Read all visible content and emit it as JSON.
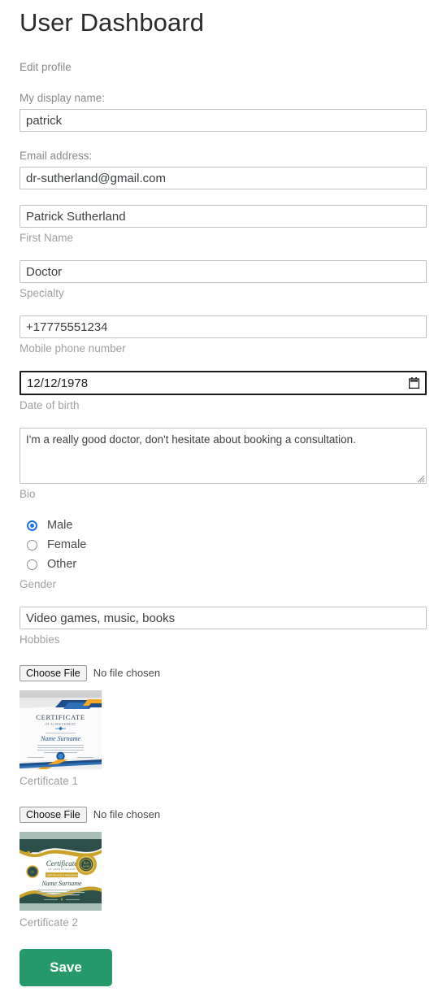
{
  "page": {
    "title": "User Dashboard",
    "section_label": "Edit profile"
  },
  "fields": {
    "display_name": {
      "label": "My display name:",
      "value": "patrick"
    },
    "email": {
      "label": "Email address:",
      "value": "dr-sutherland@gmail.com"
    },
    "first_name": {
      "value": "Patrick Sutherland",
      "helper": "First Name"
    },
    "specialty": {
      "value": "Doctor",
      "helper": "Specialty"
    },
    "mobile_phone": {
      "value": "+17775551234",
      "helper": "Mobile phone number"
    },
    "date_of_birth": {
      "value": "12/12/1978",
      "helper": "Date of birth",
      "icon": "calendar-icon"
    },
    "bio": {
      "value": "I'm a really good doctor, don't hesitate about booking a consultation.",
      "helper": "Bio"
    },
    "gender": {
      "helper": "Gender",
      "selected": "Male",
      "options": [
        {
          "label": "Male",
          "checked": true
        },
        {
          "label": "Female",
          "checked": false
        },
        {
          "label": "Other",
          "checked": false
        }
      ]
    },
    "hobbies": {
      "value": "Video games, music, books",
      "helper": "Hobbies"
    }
  },
  "uploads": [
    {
      "button_label": "Choose File",
      "status": "No file chosen",
      "caption": "Certificate 1",
      "thumbnail": "certificate-blue-gold"
    },
    {
      "button_label": "Choose File",
      "status": "No file chosen",
      "caption": "Certificate 2",
      "thumbnail": "certificate-teal-gold"
    }
  ],
  "actions": {
    "save_label": "Save"
  },
  "colors": {
    "save_button": "#26996b",
    "radio_selected": "#1a73e8",
    "label_text": "#8a8a8a",
    "input_border": "#c3c3c3",
    "date_border": "#1c1c1c"
  }
}
